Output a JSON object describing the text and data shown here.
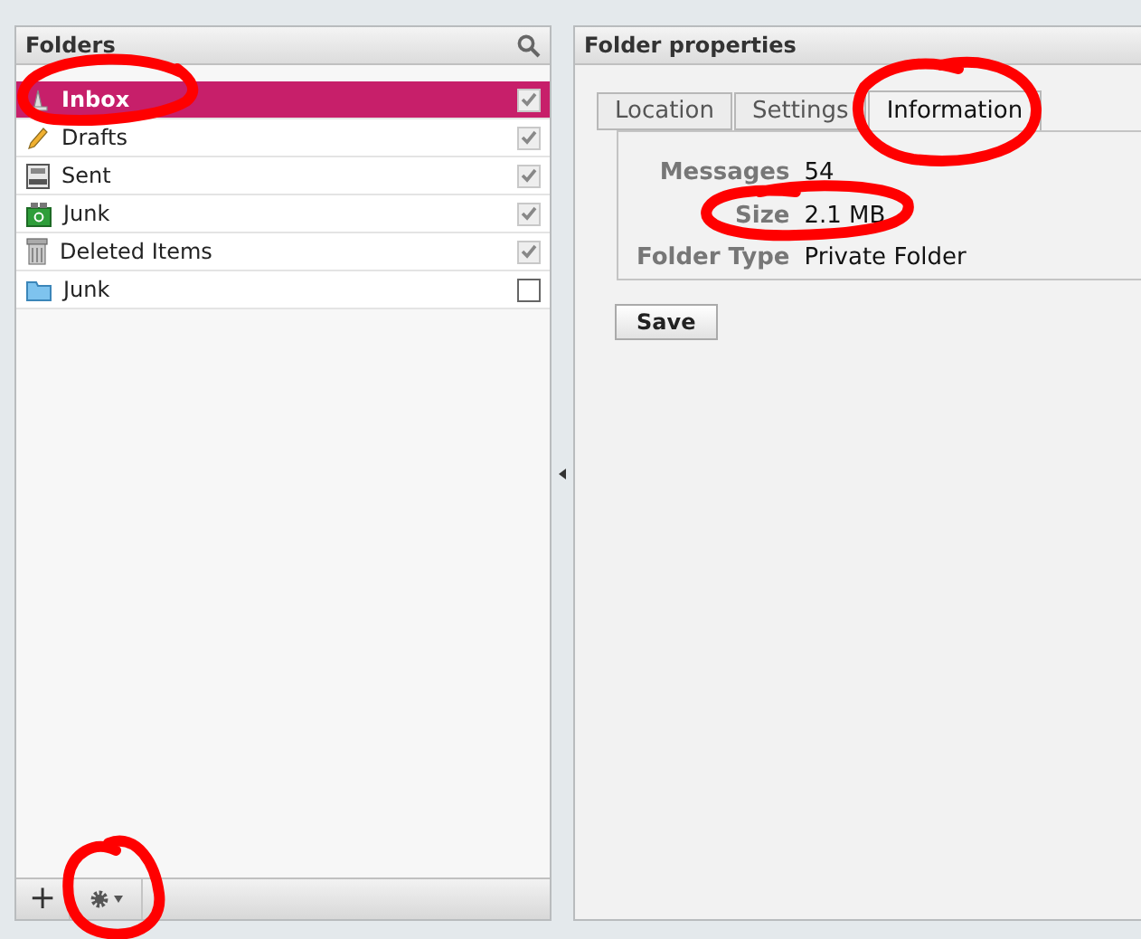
{
  "folders_panel": {
    "title": "Folders",
    "items": [
      {
        "label": "Inbox",
        "kind": "inbox",
        "selected": true,
        "checked": true
      },
      {
        "label": "Drafts",
        "kind": "drafts",
        "selected": false,
        "checked": true
      },
      {
        "label": "Sent",
        "kind": "sent",
        "selected": false,
        "checked": true
      },
      {
        "label": "Junk",
        "kind": "recycle",
        "selected": false,
        "checked": true
      },
      {
        "label": "Deleted Items",
        "kind": "trash",
        "selected": false,
        "checked": true
      },
      {
        "label": "Junk",
        "kind": "folder",
        "selected": false,
        "checked": false
      }
    ],
    "toolbar": [
      {
        "kind": "add",
        "label": "+"
      },
      {
        "kind": "gear"
      }
    ]
  },
  "properties_panel": {
    "title": "Folder properties",
    "tabs": [
      {
        "label": "Location",
        "selected": false
      },
      {
        "label": "Settings",
        "selected": false
      },
      {
        "label": "Information",
        "selected": true
      }
    ],
    "fields": [
      {
        "label": "Messages",
        "value": "54"
      },
      {
        "label": "Size",
        "value": "2.1 MB"
      },
      {
        "label": "Folder Type",
        "value": "Private Folder"
      }
    ],
    "save_button": "Save"
  },
  "annotations": [
    {
      "kind": "circle"
    },
    {
      "kind": "circle"
    },
    {
      "kind": "circle"
    },
    {
      "kind": "circle"
    }
  ]
}
